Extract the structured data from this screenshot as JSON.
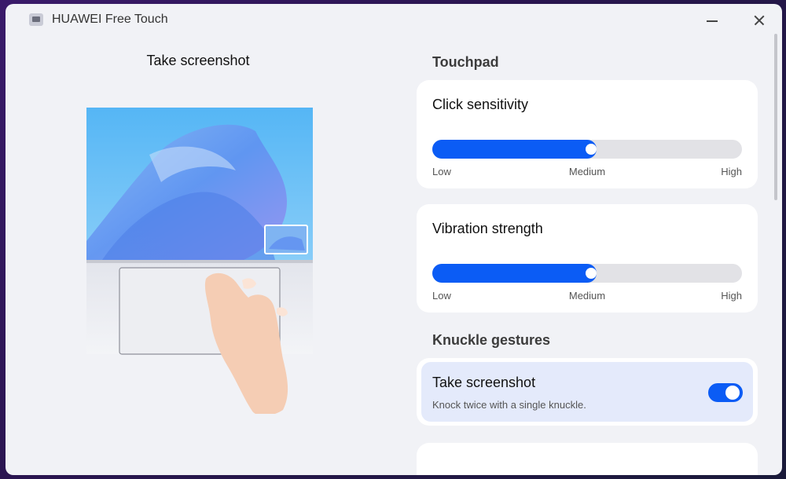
{
  "window": {
    "title": "HUAWEI Free Touch"
  },
  "left_panel": {
    "title": "Take screenshot"
  },
  "touchpad": {
    "section_title": "Touchpad",
    "click_sensitivity": {
      "title": "Click sensitivity",
      "value": "Medium",
      "level_fraction": 0.5,
      "labels": {
        "low": "Low",
        "medium": "Medium",
        "high": "High"
      }
    },
    "vibration_strength": {
      "title": "Vibration strength",
      "value": "Medium",
      "level_fraction": 0.5,
      "labels": {
        "low": "Low",
        "medium": "Medium",
        "high": "High"
      }
    }
  },
  "knuckle": {
    "section_title": "Knuckle gestures",
    "take_screenshot": {
      "title": "Take screenshot",
      "description": "Knock twice with a single knuckle.",
      "enabled": true
    }
  },
  "colors": {
    "accent": "#0b5cf5",
    "selected_card": "#e4eafb",
    "window_bg": "#f1f2f6"
  }
}
